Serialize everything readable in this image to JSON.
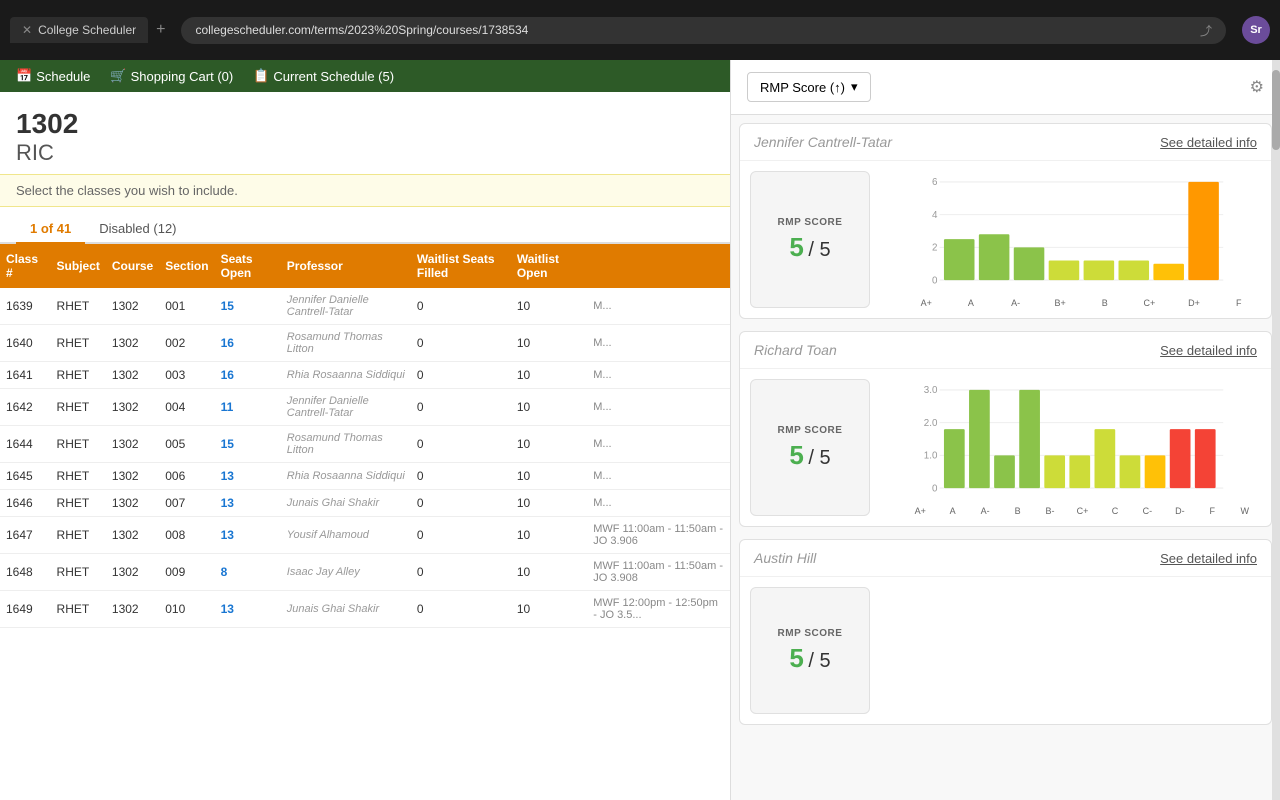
{
  "browser": {
    "url": "collegescheduler.com/terms/2023%20Spring/courses/1738534",
    "tab_title": "College Scheduler",
    "profile_initials": "Sr"
  },
  "nav": {
    "schedule_label": "Schedule",
    "cart_label": "Shopping Cart (0)",
    "current_schedule_label": "Current Schedule (5)"
  },
  "course": {
    "number": "1302",
    "code": "RIC",
    "instruction": "Select the classes you wish to include."
  },
  "tabs": [
    {
      "label": "1 of 41",
      "active": true
    },
    {
      "label": "Disabled (12)",
      "active": false
    }
  ],
  "table": {
    "columns": [
      "Class #",
      "Subject",
      "Course",
      "Section",
      "Seats Open",
      "Professor",
      "Waitlist Seats Filled",
      "Waitlist Open",
      ""
    ],
    "rows": [
      {
        "class_num": "1639",
        "subject": "RHET",
        "course": "1302",
        "section": "001",
        "seats": "15",
        "professor": "Jennifer Danielle Cantrell-Tatar",
        "waitlist_filled": "0",
        "waitlist_open": "10",
        "schedule": "M..."
      },
      {
        "class_num": "1640",
        "subject": "RHET",
        "course": "1302",
        "section": "002",
        "seats": "16",
        "professor": "Rosamund Thomas Litton",
        "waitlist_filled": "0",
        "waitlist_open": "10",
        "schedule": "M..."
      },
      {
        "class_num": "1641",
        "subject": "RHET",
        "course": "1302",
        "section": "003",
        "seats": "16",
        "professor": "Rhia Rosaanna Siddiqui",
        "waitlist_filled": "0",
        "waitlist_open": "10",
        "schedule": "M..."
      },
      {
        "class_num": "1642",
        "subject": "RHET",
        "course": "1302",
        "section": "004",
        "seats": "11",
        "professor": "Jennifer Danielle Cantrell-Tatar",
        "waitlist_filled": "0",
        "waitlist_open": "10",
        "schedule": "M..."
      },
      {
        "class_num": "1644",
        "subject": "RHET",
        "course": "1302",
        "section": "005",
        "seats": "15",
        "professor": "Rosamund Thomas Litton",
        "waitlist_filled": "0",
        "waitlist_open": "10",
        "schedule": "M..."
      },
      {
        "class_num": "1645",
        "subject": "RHET",
        "course": "1302",
        "section": "006",
        "seats": "13",
        "professor": "Rhia Rosaanna Siddiqui",
        "waitlist_filled": "0",
        "waitlist_open": "10",
        "schedule": "M..."
      },
      {
        "class_num": "1646",
        "subject": "RHET",
        "course": "1302",
        "section": "007",
        "seats": "13",
        "professor": "Junais Ghai Shakir",
        "waitlist_filled": "0",
        "waitlist_open": "10",
        "schedule": "M..."
      },
      {
        "class_num": "1647",
        "subject": "RHET",
        "course": "1302",
        "section": "008",
        "seats": "13",
        "professor": "Yousif Alhamoud",
        "waitlist_filled": "0",
        "waitlist_open": "10",
        "schedule": "MWF 11:00am - 11:50am - JO 3.906"
      },
      {
        "class_num": "1648",
        "subject": "RHET",
        "course": "1302",
        "section": "009",
        "seats": "8",
        "professor": "Isaac Jay Alley",
        "waitlist_filled": "0",
        "waitlist_open": "10",
        "schedule": "MWF 11:00am - 11:50am - JO 3.908"
      },
      {
        "class_num": "1649",
        "subject": "RHET",
        "course": "1302",
        "section": "010",
        "seats": "13",
        "professor": "Junais Ghai Shakir",
        "waitlist_filled": "0",
        "waitlist_open": "10",
        "schedule": "MWF 12:00pm - 12:50pm - JO 3.5..."
      }
    ]
  },
  "panel": {
    "sort_label": "RMP Score (↑)",
    "professors": [
      {
        "name": "Jennifer Cantrell-Tatar",
        "see_details": "See detailed info",
        "rmp_label": "RMP SCORE",
        "rmp_score": "5 / 5",
        "chart": {
          "labels": [
            "A+",
            "A",
            "A-",
            "B+",
            "B",
            "C+",
            "D+",
            "F"
          ],
          "values": [
            2.5,
            2.8,
            2.0,
            1.2,
            1.2,
            1.2,
            1.0,
            6.0
          ],
          "colors": [
            "#8bc34a",
            "#8bc34a",
            "#8bc34a",
            "#cddc39",
            "#cddc39",
            "#cddc39",
            "#ffc107",
            "#ff9800"
          ],
          "y_max": 6,
          "y_labels": [
            "0",
            "2",
            "4",
            "6"
          ]
        }
      },
      {
        "name": "Richard Toan",
        "see_details": "See detailed info",
        "rmp_label": "RMP SCORE",
        "rmp_score": "5 / 5",
        "chart": {
          "labels": [
            "A+",
            "A",
            "A-",
            "B",
            "B-",
            "C+",
            "C",
            "C-",
            "D-",
            "F",
            "W"
          ],
          "values": [
            1.8,
            3.0,
            1.0,
            3.0,
            1.0,
            1.0,
            1.8,
            1.0,
            1.0,
            1.8,
            1.8
          ],
          "colors": [
            "#8bc34a",
            "#8bc34a",
            "#8bc34a",
            "#8bc34a",
            "#cddc39",
            "#cddc39",
            "#cddc39",
            "#cddc39",
            "#ffc107",
            "#f44336",
            "#f44336"
          ],
          "y_max": 3.0,
          "y_labels": [
            "0",
            "1.0",
            "2.0",
            "3.0"
          ]
        }
      },
      {
        "name": "Austin Hill",
        "see_details": "See detailed info",
        "rmp_label": "RMP SCORE",
        "rmp_score": "5 / 5",
        "chart": {
          "labels": [],
          "values": [],
          "colors": [],
          "y_max": 5,
          "y_labels": []
        }
      }
    ]
  }
}
